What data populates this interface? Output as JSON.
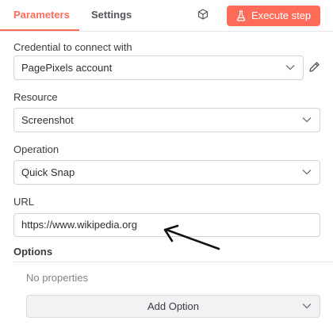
{
  "tabs": [
    {
      "label": "Parameters",
      "active": true
    },
    {
      "label": "Settings",
      "active": false
    }
  ],
  "execute_button": {
    "label": "Execute step",
    "icon": "flask-icon",
    "color": "#ff6d5a"
  },
  "accent_color": "#ff6d5a",
  "fields": {
    "credential": {
      "label": "Credential to connect with",
      "value": "PagePixels account"
    },
    "resource": {
      "label": "Resource",
      "value": "Screenshot"
    },
    "operation": {
      "label": "Operation",
      "value": "Quick Snap"
    },
    "url": {
      "label": "URL",
      "value": "https://www.wikipedia.org"
    }
  },
  "options": {
    "title": "Options",
    "empty_text": "No properties",
    "add_label": "Add Option"
  }
}
